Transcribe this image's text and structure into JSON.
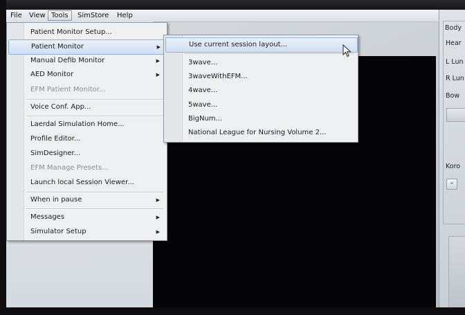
{
  "menubar": {
    "items": [
      "File",
      "View",
      "Tools",
      "SimStore",
      "Help"
    ],
    "active_index": 2
  },
  "tools_menu": {
    "items": [
      {
        "label": "Patient Monitor Setup...",
        "enabled": true
      },
      {
        "label": "Patient Monitor",
        "enabled": true,
        "submenu": true,
        "highlighted": true
      },
      {
        "label": "Manual Defib Monitor",
        "enabled": true,
        "submenu": true
      },
      {
        "label": "AED Monitor",
        "enabled": true,
        "submenu": true
      },
      {
        "label": "EFM Patient Monitor...",
        "enabled": false
      },
      {
        "label": "Voice Conf. App...",
        "enabled": true
      },
      {
        "label": "Laerdal Simulation Home...",
        "enabled": true
      },
      {
        "label": "Profile Editor...",
        "enabled": true
      },
      {
        "label": "SimDesigner...",
        "enabled": true
      },
      {
        "label": "EFM Manage Presets...",
        "enabled": false
      },
      {
        "label": "Launch local Session Viewer...",
        "enabled": true
      },
      {
        "label": "When in pause",
        "enabled": true,
        "submenu": true
      },
      {
        "label": "Messages",
        "enabled": true,
        "submenu": true
      },
      {
        "label": "Simulator Setup",
        "enabled": true,
        "submenu": true
      }
    ]
  },
  "patient_monitor_submenu": {
    "items": [
      {
        "label": "Use current session layout...",
        "highlighted": true
      },
      {
        "label": "3wave..."
      },
      {
        "label": "3waveWithEFM..."
      },
      {
        "label": "4wave..."
      },
      {
        "label": "5wave..."
      },
      {
        "label": "BigNum..."
      },
      {
        "label": "National League for Nursing Volume 2..."
      }
    ]
  },
  "right_panel": {
    "title": "Body",
    "labels": [
      "Hear",
      "L Lun",
      "R Lun",
      "Bow"
    ],
    "lower_label": "Koro",
    "minus_button": "–"
  },
  "icons": {
    "submenu_arrow": "▶",
    "cursor": "mouse-pointer-icon"
  },
  "colors": {
    "menu_bg": "#eef0f2",
    "highlight": "#cfdff2",
    "highlight_border": "#8fb0d6",
    "monitor_bg": "#040406"
  }
}
